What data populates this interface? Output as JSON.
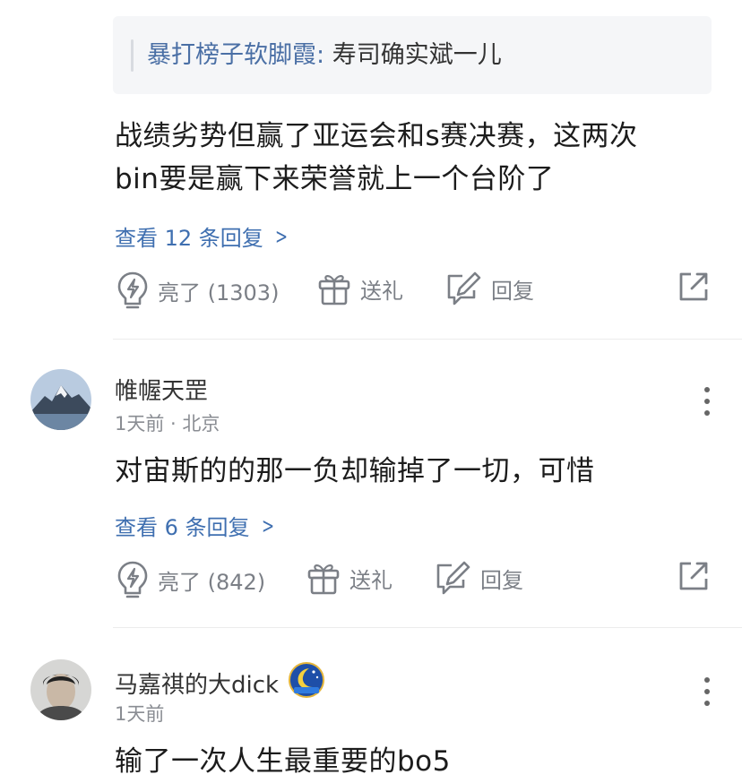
{
  "comment1": {
    "quote": {
      "author": "暴打榜子软脚霞:",
      "text": " 寿司确实斌一儿"
    },
    "body_line1": "战绩劣势但赢了亚运会和s赛决赛，这两次",
    "body_line2": "bin要是赢下来荣誉就上一个台阶了",
    "replies_link": "查看 12 条回复",
    "like_label": "亮了 (1303)",
    "gift_label": "送礼",
    "reply_label": "回复"
  },
  "comment2": {
    "username": "帷幄天罡",
    "meta": "1天前 · 北京",
    "body": "对宙斯的的那一负却输掉了一切，可惜",
    "replies_link": "查看 6 条回复",
    "like_label": "亮了 (842)",
    "gift_label": "送礼",
    "reply_label": "回复"
  },
  "comment3": {
    "username": "马嘉祺的大dick",
    "meta": "1天前",
    "body": "输了一次人生最重要的bo5"
  },
  "icons": {
    "like": "lightbulb-icon",
    "gift": "gift-icon",
    "reply": "edit-icon",
    "share": "share-icon",
    "more": "more-vertical-icon"
  },
  "colors": {
    "link_blue": "#3f6fb0",
    "quote_author": "#4a6fa5",
    "action_gray": "#7b7f86"
  }
}
